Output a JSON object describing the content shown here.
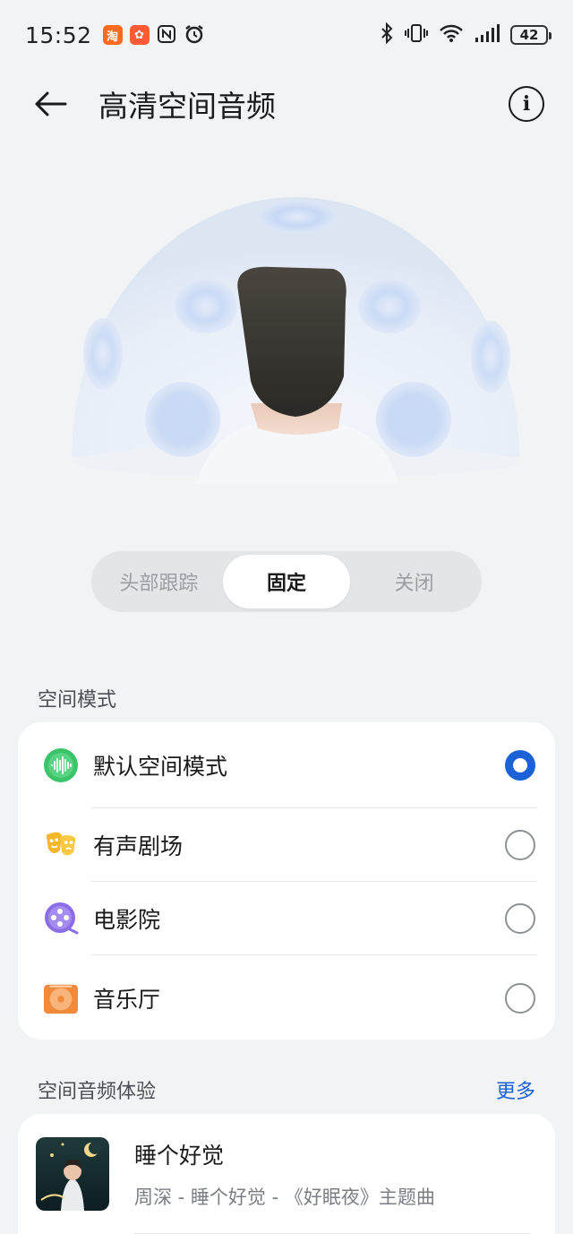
{
  "status_bar": {
    "time": "15:52",
    "battery": "42",
    "left_icons": [
      "taobao-icon",
      "app-icon",
      "nfc-icon",
      "alarm-icon"
    ],
    "right_icons": [
      "bluetooth-icon",
      "vibrate-icon",
      "wifi-icon",
      "signal-icon",
      "battery-icon"
    ]
  },
  "header": {
    "title": "高清空间音频"
  },
  "segmented": {
    "options": [
      "头部跟踪",
      "固定",
      "关闭"
    ],
    "selected": "固定"
  },
  "spatial_mode": {
    "section_title": "空间模式",
    "items": [
      {
        "label": "默认空间模式",
        "icon": "waveform-icon",
        "selected": true
      },
      {
        "label": "有声剧场",
        "icon": "theater-mask-icon",
        "selected": false
      },
      {
        "label": "电影院",
        "icon": "film-reel-icon",
        "selected": false
      },
      {
        "label": "音乐厅",
        "icon": "record-disc-icon",
        "selected": false
      }
    ]
  },
  "experience": {
    "section_title": "空间音频体验",
    "more_label": "更多",
    "tracks": [
      {
        "title": "睡个好觉",
        "subtitle": "周深 - 睡个好觉 - 《好眠夜》主题曲"
      }
    ]
  },
  "colors": {
    "accent": "#1b62d8",
    "background": "#f1f3f5"
  }
}
